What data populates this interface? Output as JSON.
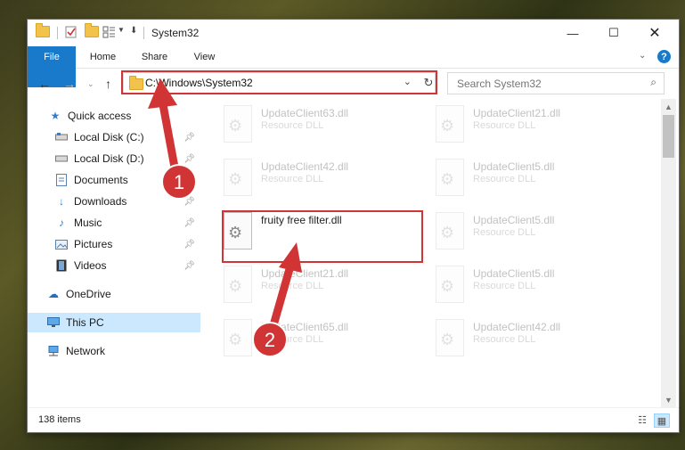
{
  "window": {
    "title": "System32"
  },
  "ribbon": {
    "tabs": [
      "File",
      "Home",
      "Share",
      "View"
    ]
  },
  "address": {
    "path": "C:\\Windows\\System32"
  },
  "search": {
    "placeholder": "Search System32"
  },
  "sidebar": {
    "quick_access": "Quick access",
    "items": [
      {
        "label": "Local Disk (C:)",
        "icon": "drive-icon",
        "pinned": true
      },
      {
        "label": "Local Disk (D:)",
        "icon": "drive-icon",
        "pinned": true
      },
      {
        "label": "Documents",
        "icon": "documents-icon",
        "pinned": true
      },
      {
        "label": "Downloads",
        "icon": "downloads-icon",
        "pinned": true
      },
      {
        "label": "Music",
        "icon": "music-icon",
        "pinned": true
      },
      {
        "label": "Pictures",
        "icon": "pictures-icon",
        "pinned": true
      },
      {
        "label": "Videos",
        "icon": "videos-icon",
        "pinned": true
      }
    ],
    "onedrive": "OneDrive",
    "this_pc": "This PC",
    "network": "Network"
  },
  "files": {
    "left": [
      {
        "name": "UpdateClient63.dll",
        "type": "Resource DLL"
      },
      {
        "name": "UpdateClient42.dll",
        "type": "Resource DLL"
      },
      {
        "name": "fruity free filter.dll",
        "type": ""
      },
      {
        "name": "UpdateClient21.dll",
        "type": "Resource DLL"
      },
      {
        "name": "UpdateClient65.dll",
        "type": "Resource DLL"
      }
    ],
    "right": [
      {
        "name": "UpdateClient21.dll",
        "type": "Resource DLL"
      },
      {
        "name": "UpdateClient5.dll",
        "type": "Resource DLL"
      },
      {
        "name": "UpdateClient5.dll",
        "type": "Resource DLL"
      },
      {
        "name": "UpdateClient5.dll",
        "type": "Resource DLL"
      },
      {
        "name": "UpdateClient42.dll",
        "type": "Resource DLL"
      }
    ]
  },
  "status": {
    "item_count": "138 items"
  },
  "annotations": {
    "step1": "1",
    "step2": "2",
    "color": "#d03434"
  },
  "colors": {
    "file_tab": "#1979ca",
    "selection": "#cce8ff",
    "folder": "#f2c24b"
  }
}
